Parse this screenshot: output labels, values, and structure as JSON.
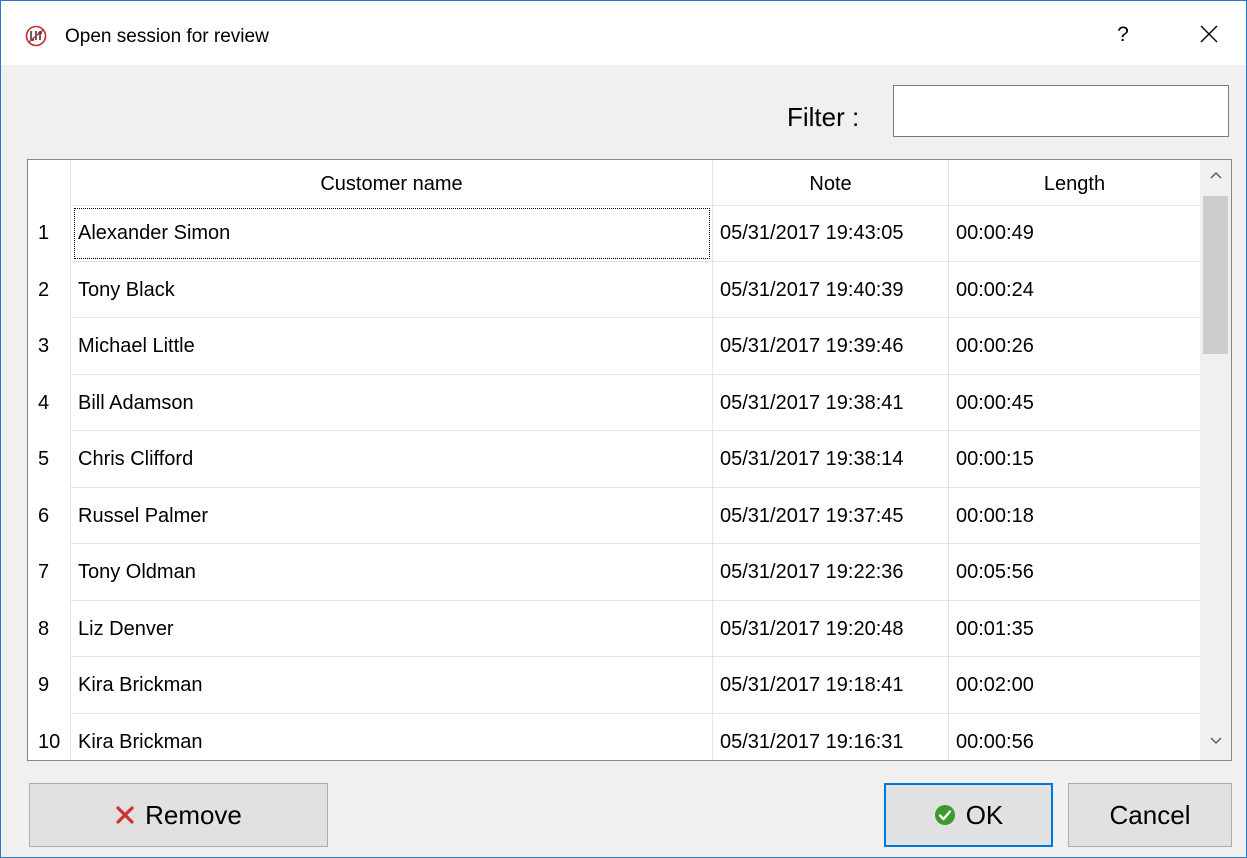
{
  "window": {
    "title": "Open session for review",
    "help_label": "?"
  },
  "filter": {
    "label": "Filter :",
    "value": "",
    "placeholder": ""
  },
  "table": {
    "columns": [
      "Customer name",
      "Note",
      "Length"
    ],
    "rows": [
      {
        "num": "1",
        "name": "Alexander Simon",
        "note": "05/31/2017 19:43:05",
        "length": "00:00:49"
      },
      {
        "num": "2",
        "name": "Tony Black",
        "note": "05/31/2017 19:40:39",
        "length": "00:00:24"
      },
      {
        "num": "3",
        "name": "Michael Little",
        "note": "05/31/2017 19:39:46",
        "length": "00:00:26"
      },
      {
        "num": "4",
        "name": "Bill Adamson",
        "note": "05/31/2017 19:38:41",
        "length": "00:00:45"
      },
      {
        "num": "5",
        "name": "Chris Clifford",
        "note": "05/31/2017 19:38:14",
        "length": "00:00:15"
      },
      {
        "num": "6",
        "name": "Russel Palmer",
        "note": "05/31/2017 19:37:45",
        "length": "00:00:18"
      },
      {
        "num": "7",
        "name": "Tony Oldman",
        "note": "05/31/2017 19:22:36",
        "length": "00:05:56"
      },
      {
        "num": "8",
        "name": "Liz Denver",
        "note": "05/31/2017 19:20:48",
        "length": "00:01:35"
      },
      {
        "num": "9",
        "name": "Kira Brickman",
        "note": "05/31/2017 19:18:41",
        "length": "00:02:00"
      },
      {
        "num": "10",
        "name": "Kira Brickman",
        "note": "05/31/2017 19:16:31",
        "length": "00:00:56"
      }
    ]
  },
  "buttons": {
    "remove_label": "Remove",
    "ok_label": "OK",
    "cancel_label": "Cancel"
  },
  "icons": {
    "app": "app-logo-icon",
    "close": "close-icon",
    "remove": "x-mark-icon",
    "ok": "check-circle-icon",
    "scroll_up": "chevron-up-icon",
    "scroll_down": "chevron-down-icon"
  },
  "colors": {
    "window_border": "#2b79c2",
    "remove_icon": "#d32f2f",
    "ok_icon": "#3c9a2f",
    "ok_focus_border": "#0078d7",
    "app_icon": "#c62828"
  }
}
